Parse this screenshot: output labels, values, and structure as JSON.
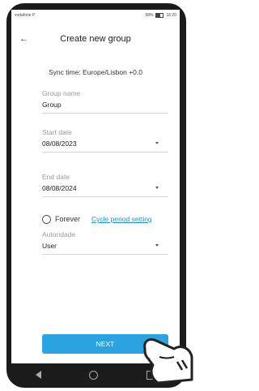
{
  "status_bar": {
    "carrier": "vodafone P",
    "signal_icons": "signal-wifi-icon",
    "right_text": "58%",
    "time": "16:20"
  },
  "header": {
    "title": "Create new group"
  },
  "sync": {
    "text": "Sync time: Europe/Lisbon +0.0"
  },
  "group_name": {
    "label": "Group name",
    "value": "Group"
  },
  "start_date": {
    "label": "Start date",
    "value": "08/08/2023"
  },
  "end_date": {
    "label": "End date",
    "value": "08/08/2024"
  },
  "forever": {
    "label": "Forever",
    "checked": false
  },
  "cycle_link": {
    "label": "Cycle period setting"
  },
  "autoridade": {
    "label": "Autoridade",
    "value": "User"
  },
  "next_button": {
    "label": "NEXT"
  },
  "colors": {
    "accent": "#2aa3e0",
    "link": "#1f8fd6"
  }
}
